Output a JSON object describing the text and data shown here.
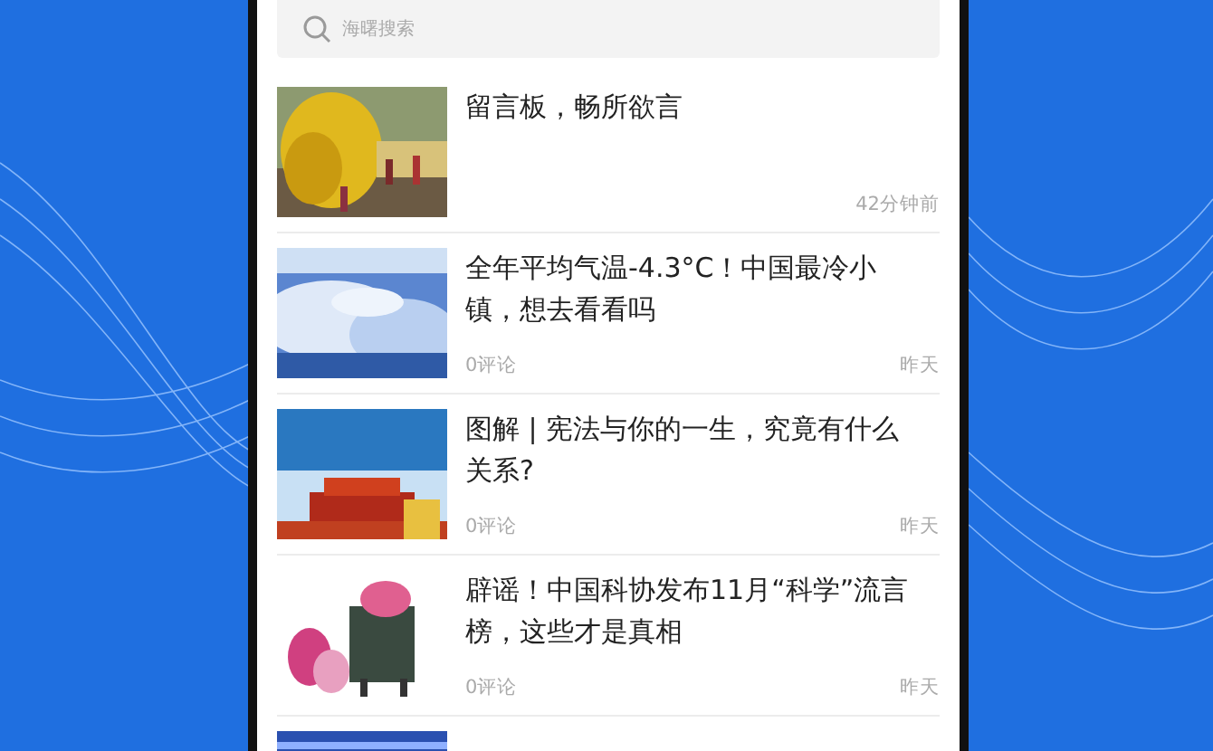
{
  "search": {
    "placeholder": "海曙搜索"
  },
  "articles": [
    {
      "title": "留言板，畅所欲言",
      "time": "42分钟前",
      "picture": {
        "kind": "picture"
      }
    },
    {
      "title": "全年平均气温-4.3°C！中国最冷小镇，想去看看吗",
      "comments": "0评论",
      "time": "昨天",
      "picture": {
        "kind": "picture"
      }
    },
    {
      "title": "图解 | 宪法与你的一生，究竟有什么关系?",
      "comments": "0评论",
      "time": "昨天",
      "picture": {
        "kind": "picture"
      }
    },
    {
      "title": "辟谣！中国科协发布11月“科学”流言榜，这些才是真相",
      "comments": "0评论",
      "time": "昨天",
      "picture": {
        "kind": "picture"
      }
    },
    {
      "picture": {
        "kind": "picture"
      }
    }
  ]
}
